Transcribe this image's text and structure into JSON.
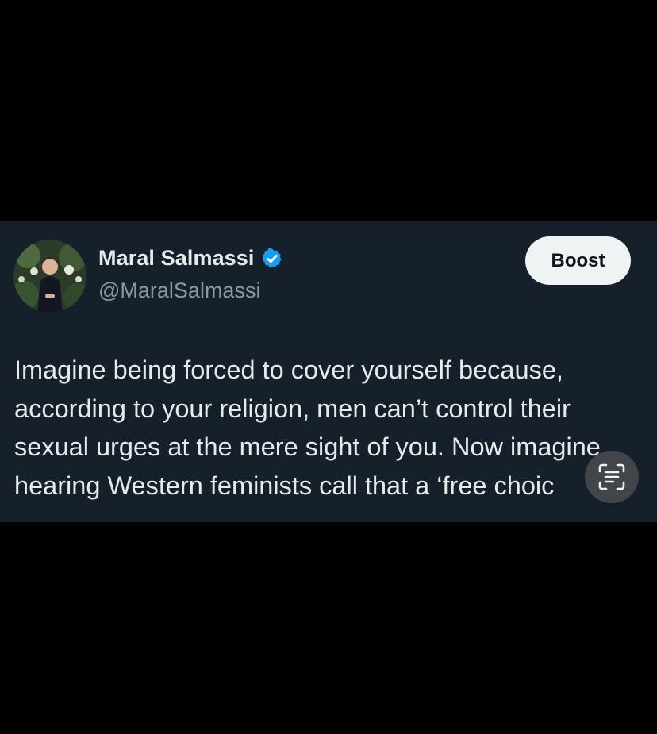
{
  "post": {
    "author_name": "Maral Salmassi",
    "handle": "@MaralSalmassi",
    "verified": true,
    "boost_label": "Boost",
    "text_lines": [
      "Imagine being forced to cover yourself because,",
      "according to your religion, men can’t control their",
      "sexual urges at the mere sight of you. Now imagine",
      "hearing Western feminists call that a ‘free choic"
    ]
  },
  "icons": {
    "verified": "verified-badge-icon",
    "scan": "text-scan-icon"
  },
  "colors": {
    "background": "#000000",
    "card": "#15202b",
    "primary_text": "#e7e9ea",
    "secondary_text": "#8b98a5",
    "verified_blue": "#1d9bf0",
    "button_bg": "#eff3f4"
  }
}
